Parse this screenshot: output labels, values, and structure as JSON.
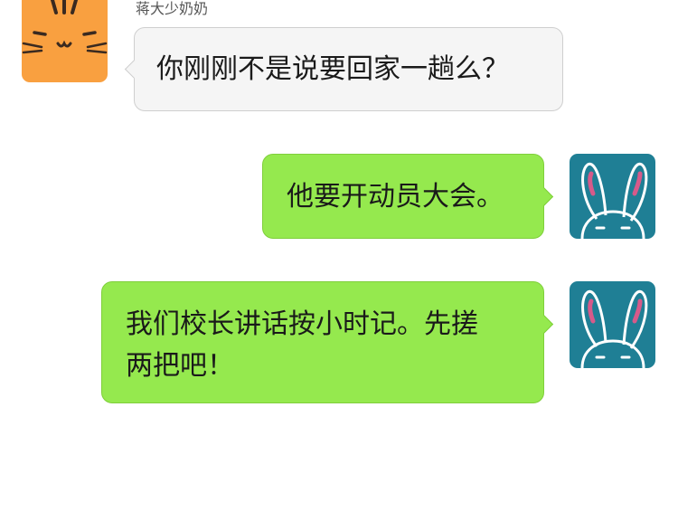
{
  "messages": [
    {
      "sender_name": "蒋大少奶奶",
      "text": "你刚刚不是说要回家一趟么？",
      "direction": "incoming",
      "avatar": "cat-avatar-icon"
    },
    {
      "text": "他要开动员大会。",
      "direction": "outgoing",
      "avatar": "rabbit-avatar-icon"
    },
    {
      "text": "我们校长讲话按小时记。先搓\n两把吧！",
      "direction": "outgoing",
      "avatar": "rabbit-avatar-icon"
    }
  ],
  "colors": {
    "incoming_bubble": "#f5f5f5",
    "outgoing_bubble": "#95e94e",
    "cat_avatar_bg": "#f9a040",
    "rabbit_avatar_bg": "#1f7f95"
  }
}
